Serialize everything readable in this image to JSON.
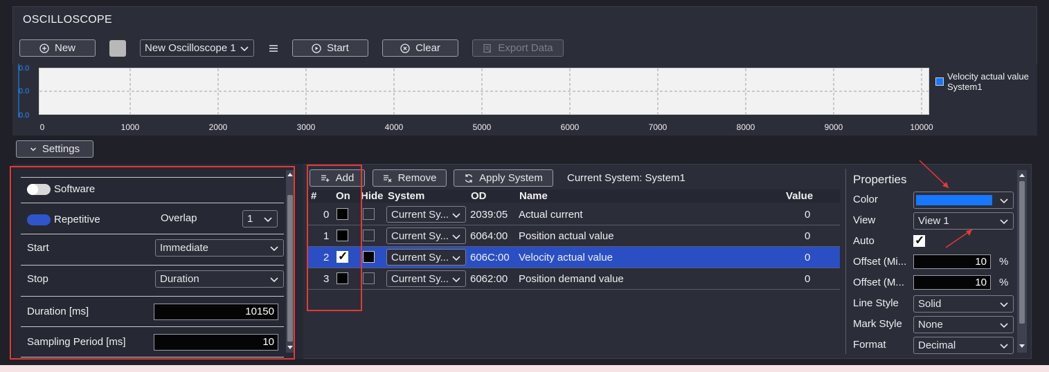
{
  "app": {
    "title": "OSCILLOSCOPE"
  },
  "toolbar": {
    "new_label": "New",
    "oscilloscope_select": "New Oscilloscope 1",
    "start_label": "Start",
    "clear_label": "Clear",
    "export_label": "Export Data"
  },
  "chart_data": {
    "type": "line",
    "x_ticks": [
      "0",
      "1000",
      "2000",
      "3000",
      "4000",
      "5000",
      "6000",
      "7000",
      "8000",
      "9000",
      "10000"
    ],
    "y_ticks": [
      "0.0",
      "0.0",
      "0.0"
    ],
    "xlim": [
      0,
      10000
    ],
    "series": [
      {
        "name": "Velocity actual value System1",
        "color": "#1677ff",
        "values": []
      }
    ],
    "legend": "right",
    "grid": true
  },
  "legend": {
    "line1": "Velocity actual value",
    "line2": "System1"
  },
  "settings": {
    "toggle_label": "Settings",
    "software_label": "Software",
    "software_on": false,
    "repetitive_label": "Repetitive",
    "repetitive_on": true,
    "overlap_label": "Overlap",
    "overlap_value": "1",
    "start_label": "Start",
    "start_value": "Immediate",
    "stop_label": "Stop",
    "stop_value": "Duration",
    "duration_label": "Duration [ms]",
    "duration_value": "10150",
    "sampling_label": "Sampling Period [ms]",
    "sampling_value": "10"
  },
  "channels": {
    "add_label": "Add",
    "remove_label": "Remove",
    "apply_label": "Apply System",
    "current_system": "Current System: System1",
    "headers": {
      "num": "#",
      "on": "On",
      "hide": "Hide",
      "system": "System",
      "od": "OD",
      "name": "Name",
      "value": "Value"
    },
    "rows": [
      {
        "num": "0",
        "on": false,
        "hide": false,
        "system": "Current Sy...",
        "od": "2039:05",
        "name": "Actual current",
        "value": "0",
        "selected": false
      },
      {
        "num": "1",
        "on": false,
        "hide": false,
        "system": "Current Sy...",
        "od": "6064:00",
        "name": "Position actual value",
        "value": "0",
        "selected": false
      },
      {
        "num": "2",
        "on": true,
        "hide": false,
        "system": "Current Sy...",
        "od": "606C:00",
        "name": "Velocity actual value",
        "value": "0",
        "selected": true
      },
      {
        "num": "3",
        "on": false,
        "hide": false,
        "system": "Current Sy...",
        "od": "6062:00",
        "name": "Position demand value",
        "value": "0",
        "selected": false
      }
    ]
  },
  "properties": {
    "title": "Properties",
    "color_label": "Color",
    "color_value": "#1677ff",
    "view_label": "View",
    "view_value": "View 1",
    "auto_label": "Auto",
    "auto_checked": true,
    "offset_min_label": "Offset (Mi...",
    "offset_min_value": "10",
    "offset_max_label": "Offset (M...",
    "offset_max_value": "10",
    "percent": "%",
    "line_style_label": "Line Style",
    "line_style_value": "Solid",
    "mark_style_label": "Mark Style",
    "mark_style_value": "None",
    "format_label": "Format",
    "format_value": "Decimal"
  }
}
